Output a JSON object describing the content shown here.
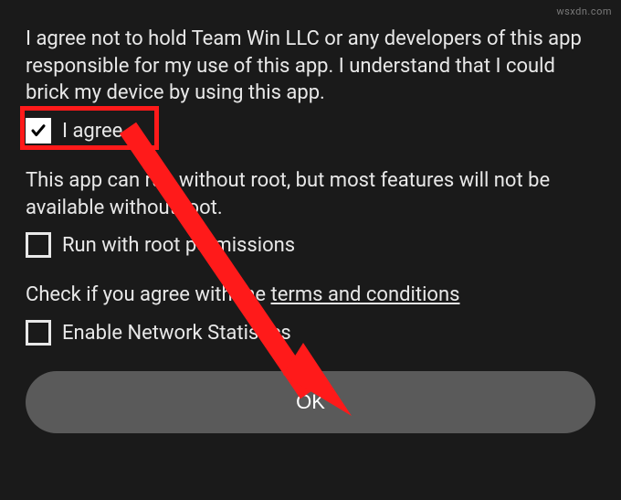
{
  "disclaimer": {
    "liability_text": "I agree not to hold Team Win LLC or any developers of this app responsible for my use of this app. I understand that I could brick my device by using this app.",
    "agree_label": "I agree",
    "agree_checked": true
  },
  "root": {
    "info_text": "This app can run without root, but most features will not be available without root.",
    "run_root_label": "Run with root permissions",
    "run_root_checked": false
  },
  "terms": {
    "prefix_text": "Check if you agree with the ",
    "link_text": "terms and conditions",
    "enable_stats_label": "Enable Network Statistics",
    "enable_stats_checked": false
  },
  "buttons": {
    "ok_label": "OK"
  },
  "watermark": "wsxdn.com",
  "annotation": {
    "highlight_color": "#ff1a1a",
    "arrow_color": "#ff1a1a"
  }
}
